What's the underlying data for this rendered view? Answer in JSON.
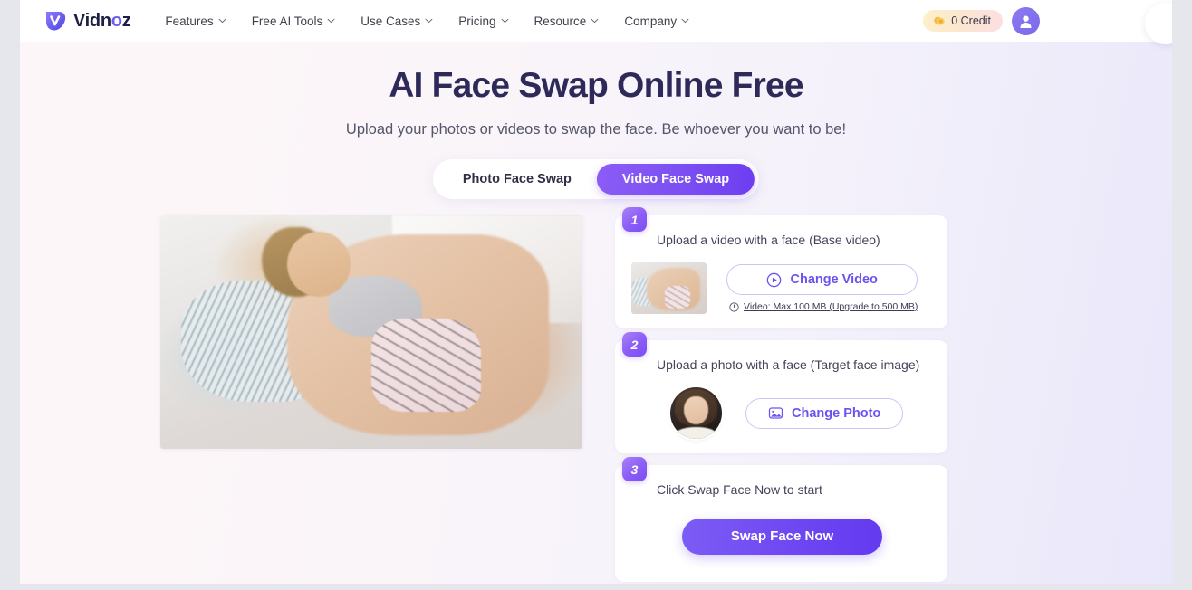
{
  "header": {
    "logo_text_1": "Vidn",
    "logo_text_o": "o",
    "logo_text_2": "z",
    "logo_icon": "vidnoz-logo-icon",
    "nav_items": [
      {
        "label": "Features",
        "icon": "chevron-down-icon"
      },
      {
        "label": "Free AI Tools",
        "icon": "chevron-down-icon"
      },
      {
        "label": "Use Cases",
        "icon": "chevron-down-icon"
      },
      {
        "label": "Pricing",
        "icon": "chevron-down-icon"
      },
      {
        "label": "Resource",
        "icon": "chevron-down-icon"
      },
      {
        "label": "Company",
        "icon": "chevron-down-icon"
      }
    ],
    "credit_label": "0 Credit",
    "credit_icon": "coin-icon",
    "avatar_icon": "user-avatar-icon"
  },
  "hero": {
    "title": "AI Face Swap Online Free",
    "subtitle": "Upload your photos or videos to swap the face. Be whoever you want to be!"
  },
  "tabs": [
    {
      "label": "Photo Face Swap",
      "active": false
    },
    {
      "label": "Video Face Swap",
      "active": true
    }
  ],
  "preview": {
    "alt": "base-video-preview"
  },
  "steps": [
    {
      "number": "1",
      "title": "Upload a video with a face (Base video)",
      "button_label": "Change Video",
      "button_icon": "play-circle-icon",
      "note_icon": "info-circle-icon",
      "note_text": "Video: Max 100 MB (Upgrade to 500 MB)",
      "thumb": "base-video-thumbnail"
    },
    {
      "number": "2",
      "title": "Upload a photo with a face (Target face image)",
      "button_label": "Change Photo",
      "button_icon": "image-icon",
      "thumb": "target-face-thumbnail"
    },
    {
      "number": "3",
      "title": "Click Swap Face Now to start",
      "cta_label": "Swap Face Now"
    }
  ],
  "colors": {
    "brand_purple": "#6d46f2",
    "title_navy": "#2d2a5a",
    "badge_gradient_start": "#a982f5",
    "badge_gradient_end": "#7c4df2",
    "credit_pill_start": "#fdf0c8",
    "credit_pill_end": "#fbdfe0"
  }
}
